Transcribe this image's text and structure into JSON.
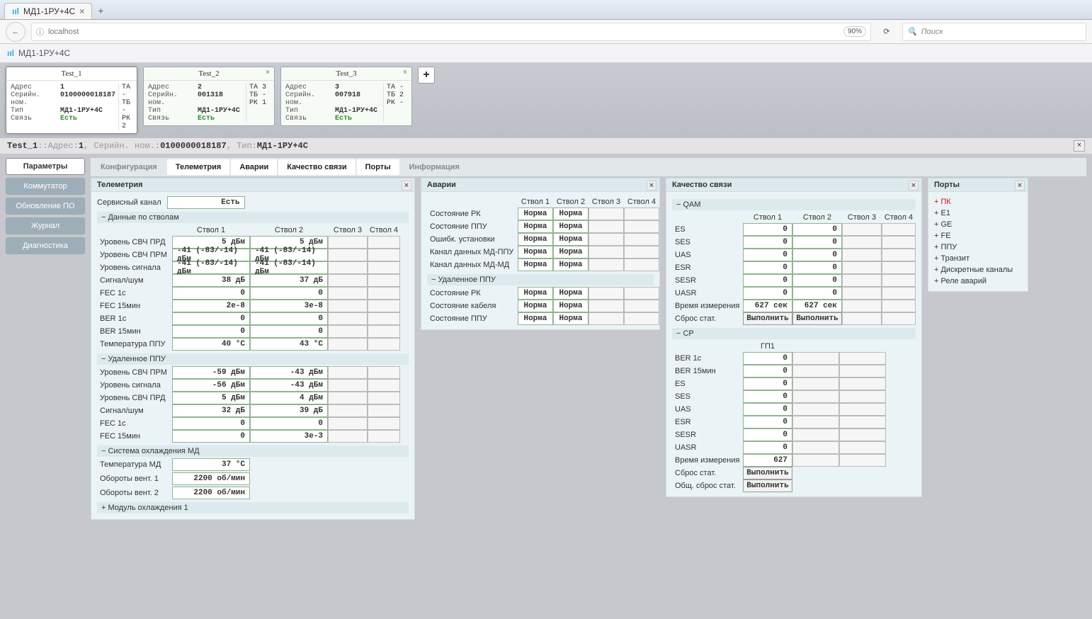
{
  "browser": {
    "tab_title": "МД1-1РУ+4С",
    "url": "localhost",
    "zoom": "90%",
    "search_placeholder": "Поиск"
  },
  "app_title": "МД1-1РУ+4С",
  "devices": [
    {
      "name": "Test_1",
      "addr": "1",
      "serial": "0100000018187",
      "type": "МД1-1РУ+4С",
      "link": "Есть",
      "ta": "-",
      "tb": "-",
      "rk": "2",
      "active": true,
      "closable": false
    },
    {
      "name": "Test_2",
      "addr": "2",
      "serial": "001318",
      "type": "МД1-1РУ+4С",
      "link": "Есть",
      "ta": "3",
      "tb": "-",
      "rk": "1",
      "active": false,
      "closable": true
    },
    {
      "name": "Test_3",
      "addr": "3",
      "serial": "007918",
      "type": "МД1-1РУ+4С",
      "link": "Есть",
      "ta": "-",
      "tb": "2",
      "rk": "-",
      "active": false,
      "closable": true
    }
  ],
  "dev_labels": {
    "addr": "Адрес",
    "serial": "Серийн. ном.",
    "type": "Тип",
    "link": "Связь",
    "ta": "ТА",
    "tb": "ТБ",
    "rk": "РК"
  },
  "selection": {
    "name": "Test_1",
    "sep": " :: ",
    "addr_lbl": "Адрес: ",
    "addr": "1",
    "serial_lbl": ", Серийн. ном.: ",
    "serial": "0100000018187",
    "type_lbl": ", Тип: ",
    "type": "МД1-1РУ+4С"
  },
  "side_nav": [
    "Параметры",
    "Коммутатор",
    "Обновление ПО",
    "Журнал",
    "Диагностика"
  ],
  "side_nav_active": 0,
  "top_tabs": [
    "Конфигурация",
    "Телеметрия",
    "Аварии",
    "Качество связи",
    "Порты",
    "Информация"
  ],
  "top_tabs_active": [
    1,
    2,
    3,
    4
  ],
  "telemetry": {
    "title": "Телеметрия",
    "service_channel_lbl": "Сервисный канал",
    "service_channel_val": "Есть",
    "grp_stvol": "− Данные по стволам",
    "cols": [
      "Ствол 1",
      "Ствол 2",
      "Ствол 3",
      "Ствол 4"
    ],
    "rows": [
      {
        "lbl": "Уровень СВЧ ПРД",
        "v": [
          "5 дБм",
          "5 дБм",
          "",
          ""
        ]
      },
      {
        "lbl": "Уровень СВЧ ПРМ",
        "v": [
          "-41 (-83/-14) дБм",
          "-41 (-83/-14) дБм",
          "",
          ""
        ]
      },
      {
        "lbl": "Уровень сигнала",
        "v": [
          "-41 (-83/-14) дБм",
          "-41 (-83/-14) дБм",
          "",
          ""
        ]
      },
      {
        "lbl": "Сигнал/шум",
        "v": [
          "38 дБ",
          "37 дБ",
          "",
          ""
        ]
      },
      {
        "lbl": "FEC 1с",
        "v": [
          "0",
          "0",
          "",
          ""
        ]
      },
      {
        "lbl": "FEC 15мин",
        "v": [
          "2e-8",
          "3e-8",
          "",
          ""
        ]
      },
      {
        "lbl": "BER 1с",
        "v": [
          "0",
          "0",
          "",
          ""
        ]
      },
      {
        "lbl": "BER 15мин",
        "v": [
          "0",
          "0",
          "",
          ""
        ]
      },
      {
        "lbl": "Температура ППУ",
        "v": [
          "40 °C",
          "43 °C",
          "",
          ""
        ]
      }
    ],
    "grp_remote": "− Удаленное ППУ",
    "rows2": [
      {
        "lbl": "Уровень СВЧ ПРМ",
        "v": [
          "-59 дБм",
          "-43 дБм",
          "",
          ""
        ]
      },
      {
        "lbl": "Уровень сигнала",
        "v": [
          "-56 дБм",
          "-43 дБм",
          "",
          ""
        ]
      },
      {
        "lbl": "Уровень СВЧ ПРД",
        "v": [
          "5 дБм",
          "4 дБм",
          "",
          ""
        ]
      },
      {
        "lbl": "Сигнал/шум",
        "v": [
          "32 дБ",
          "39 дБ",
          "",
          ""
        ]
      },
      {
        "lbl": "FEC 1с",
        "v": [
          "0",
          "0",
          "",
          ""
        ]
      },
      {
        "lbl": "FEC 15мин",
        "v": [
          "0",
          "3e-3",
          "",
          ""
        ]
      }
    ],
    "grp_cool": "− Система охлаждения МД",
    "rows3": [
      {
        "lbl": "Температура МД",
        "v": [
          "37 °C"
        ]
      },
      {
        "lbl": "Обороты вент. 1",
        "v": [
          "2200 об/мин"
        ]
      },
      {
        "lbl": "Обороты вент. 2",
        "v": [
          "2200 об/мин"
        ]
      }
    ],
    "grp_cool2": "+ Модуль охлаждения 1"
  },
  "alarms": {
    "title": "Аварии",
    "cols": [
      "Ствол 1",
      "Ствол 2",
      "Ствол 3",
      "Ствол 4"
    ],
    "norm": "Норма",
    "rows": [
      "Состояние РК",
      "Состояние ППУ",
      "Ошибк. установки",
      "Канал данных МД-ППУ",
      "Канал данных МД-МД"
    ],
    "grp_remote": "− Удаленное ППУ",
    "rows2": [
      "Состояние РК",
      "Состояние кабеля",
      "Состояние ППУ"
    ]
  },
  "quality": {
    "title": "Качество связи",
    "grp_qam": "− QAM",
    "cols": [
      "Ствол 1",
      "Ствол 2",
      "Ствол 3",
      "Ствол 4"
    ],
    "rows": [
      {
        "lbl": "ES",
        "v": [
          "0",
          "0",
          "",
          ""
        ]
      },
      {
        "lbl": "SES",
        "v": [
          "0",
          "0",
          "",
          ""
        ]
      },
      {
        "lbl": "UAS",
        "v": [
          "0",
          "0",
          "",
          ""
        ]
      },
      {
        "lbl": "ESR",
        "v": [
          "0",
          "0",
          "",
          ""
        ]
      },
      {
        "lbl": "SESR",
        "v": [
          "0",
          "0",
          "",
          ""
        ]
      },
      {
        "lbl": "UASR",
        "v": [
          "0",
          "0",
          "",
          ""
        ]
      },
      {
        "lbl": "Время измерения",
        "v": [
          "627 сек",
          "627 сек",
          "",
          ""
        ]
      }
    ],
    "reset_lbl": "Сброс стат.",
    "reset_btn": "Выполнить",
    "grp_cp": "− СР",
    "cp_col": "ГП1",
    "rows2": [
      {
        "lbl": "BER 1с",
        "v": [
          "0",
          "",
          "",
          ""
        ]
      },
      {
        "lbl": "BER 15мин",
        "v": [
          "0",
          "",
          "",
          ""
        ]
      },
      {
        "lbl": "ES",
        "v": [
          "0",
          "",
          "",
          ""
        ]
      },
      {
        "lbl": "SES",
        "v": [
          "0",
          "",
          "",
          ""
        ]
      },
      {
        "lbl": "UAS",
        "v": [
          "0",
          "",
          "",
          ""
        ]
      },
      {
        "lbl": "ESR",
        "v": [
          "0",
          "",
          "",
          ""
        ]
      },
      {
        "lbl": "SESR",
        "v": [
          "0",
          "",
          "",
          ""
        ]
      },
      {
        "lbl": "UASR",
        "v": [
          "0",
          "",
          "",
          ""
        ]
      },
      {
        "lbl": "Время измерения",
        "v": [
          "627",
          "",
          "",
          ""
        ]
      }
    ],
    "reset2_lbl": "Сброс стат.",
    "reset3_lbl": "Общ. сброс стат."
  },
  "ports": {
    "title": "Порты",
    "items": [
      {
        "t": "+ ПК",
        "red": true
      },
      {
        "t": "+ E1"
      },
      {
        "t": "+ GE"
      },
      {
        "t": "+ FE"
      },
      {
        "t": "+ ППУ"
      },
      {
        "t": "+ Транзит"
      },
      {
        "t": "+ Дискретные каналы"
      },
      {
        "t": "+ Реле аварий"
      }
    ]
  }
}
